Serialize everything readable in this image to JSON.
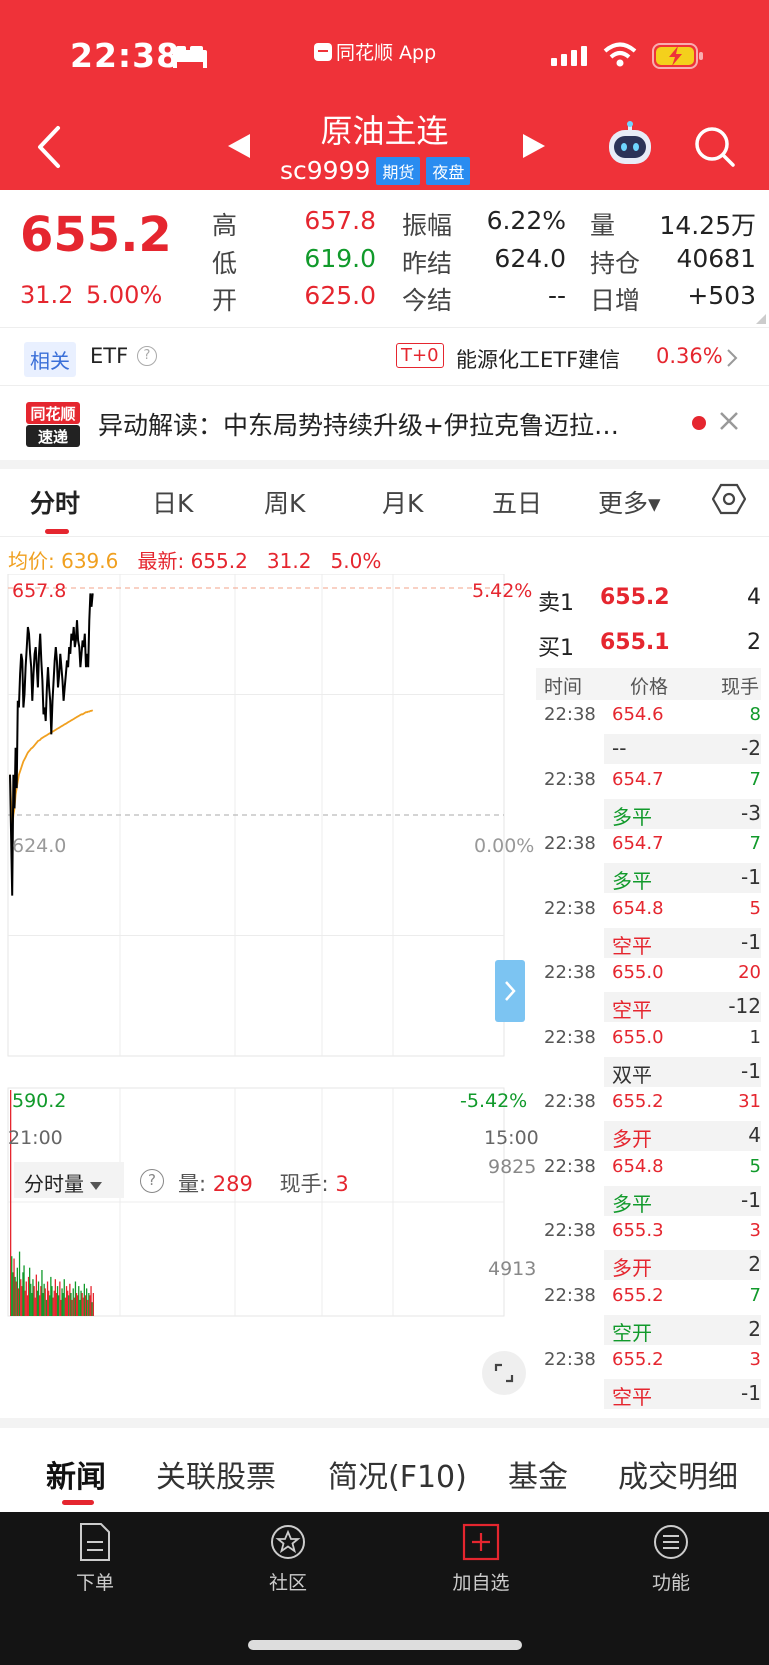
{
  "status_bar": {
    "time": "22:38",
    "app_label": "同花顺 App"
  },
  "header": {
    "title": "原油主连",
    "code": "sc9999",
    "tags": [
      "期货",
      "夜盘"
    ]
  },
  "quote": {
    "last": "655.2",
    "change": "31.2",
    "change_pct": "5.00%",
    "fields": [
      {
        "label": "高",
        "value": "657.8",
        "color": "#e5262f"
      },
      {
        "label": "振幅",
        "value": "6.22%",
        "color": "#222222"
      },
      {
        "label": "量",
        "value": "14.25万",
        "color": "#222222"
      },
      {
        "label": "低",
        "value": "619.0",
        "color": "#119a2b"
      },
      {
        "label": "昨结",
        "value": "624.0",
        "color": "#222222"
      },
      {
        "label": "持仓",
        "value": "40681",
        "color": "#222222"
      },
      {
        "label": "开",
        "value": "625.0",
        "color": "#e5262f"
      },
      {
        "label": "今结",
        "value": "--",
        "color": "#222222"
      },
      {
        "label": "日增",
        "value": "+503",
        "color": "#222222"
      }
    ]
  },
  "etf": {
    "related": "相关",
    "label": "ETF",
    "help": "?",
    "t0": "T+0",
    "name": "能源化工ETF建信",
    "change": "0.36%"
  },
  "news": {
    "logo_top": "同花顺",
    "logo_bottom": "速递",
    "text": "异动解读：中东局势持续升级+伊拉克鲁迈拉…"
  },
  "period_tabs": [
    "分时",
    "日K",
    "周K",
    "月K",
    "五日",
    "更多▾"
  ],
  "chart_header": {
    "avg_label": "均价:",
    "avg_value": "639.6",
    "latest_label": "最新:",
    "latest_value": "655.2",
    "change": "31.2",
    "change_pct": "5.0%"
  },
  "chart_data": {
    "type": "line",
    "x_start": "21:00",
    "x_end": "15:00",
    "ylim": [
      590.2,
      657.8
    ],
    "reference": 624.0,
    "price_labels": {
      "top": "657.8",
      "mid": "624.0",
      "bottom": "590.2"
    },
    "pct_labels": {
      "top": "5.42%",
      "mid": "0.00%",
      "bottom": "-5.42%"
    },
    "series": [
      {
        "values": [
          630,
          621,
          612,
          630,
          625,
          634,
          628,
          641,
          640,
          645,
          648,
          647,
          640,
          642,
          646,
          649,
          652,
          651,
          648,
          646,
          641,
          645,
          648,
          649,
          646,
          643,
          648,
          651,
          647,
          644,
          639,
          640,
          638,
          643,
          646,
          643,
          641,
          636,
          641,
          644,
          647,
          649,
          647,
          643,
          645,
          648,
          646,
          644,
          641,
          643,
          645,
          647,
          646,
          649,
          648,
          651,
          650,
          652,
          649,
          650,
          653,
          650,
          649,
          646,
          648,
          650,
          649,
          651,
          646,
          648,
          646,
          653,
          657,
          655,
          657
        ]
      },
      {
        "values": [
          630,
          626,
          622,
          624,
          625,
          627,
          628,
          629,
          630,
          630.5,
          631,
          631.5,
          632,
          632.3,
          632.6,
          633,
          633.3,
          633.5,
          633.7,
          633.9,
          634,
          634.2,
          634.4,
          634.6,
          634.8,
          635,
          635.1,
          635.2,
          635.4,
          635.5,
          635.6,
          635.7,
          635.8,
          635.9,
          636,
          636.1,
          636.2,
          636.3,
          636.4,
          636.5,
          636.6,
          636.7,
          636.8,
          636.9,
          637,
          637.1,
          637.2,
          637.3,
          637.4,
          637.5,
          637.6,
          637.7,
          637.8,
          637.9,
          638,
          638.1,
          638.2,
          638.3,
          638.4,
          638.5,
          638.6,
          638.7,
          638.8,
          638.9,
          639,
          639,
          639.1,
          639.2,
          639.3,
          639.3,
          639.4,
          639.4,
          639.5,
          639.5,
          639.6
        ]
      }
    ],
    "volume": {
      "ymax_label": "9825",
      "ymid_label": "4913",
      "values": [
        9825,
        2600,
        1900,
        2500,
        1700,
        1500,
        2100,
        1200,
        2800,
        1600,
        1300,
        1900,
        2200,
        1100,
        1500,
        900,
        1700,
        2100,
        1400,
        1000,
        1600,
        1300,
        800,
        1800,
        1100,
        1500,
        900,
        1300,
        2000,
        1000,
        1400,
        1200,
        700,
        1500,
        1100,
        900,
        1700,
        1300,
        800,
        1100,
        1600,
        1000,
        1300,
        900,
        1500,
        700,
        1200,
        1000,
        1600,
        800,
        1300,
        1100,
        900,
        1400,
        1000,
        700,
        1200,
        800,
        1500,
        1000,
        900,
        1300,
        700,
        1100,
        1000,
        800,
        1400,
        900,
        1200,
        700,
        1000,
        900,
        1300,
        600,
        1000
      ]
    }
  },
  "order_book": {
    "sell": {
      "label": "卖1",
      "price": "655.2",
      "vol": "4"
    },
    "buy": {
      "label": "买1",
      "price": "655.1",
      "vol": "2"
    }
  },
  "ticks_header": {
    "time": "时间",
    "price": "价格",
    "vol": "现手"
  },
  "ticks": [
    {
      "time": "22:38",
      "price": "654.6",
      "vol": "8",
      "vol_color": "#119a2b",
      "nature": "--",
      "nature_color": "#333333",
      "oi": "-2"
    },
    {
      "time": "22:38",
      "price": "654.7",
      "vol": "7",
      "vol_color": "#119a2b",
      "nature": "多平",
      "nature_color": "#119a2b",
      "oi": "-3"
    },
    {
      "time": "22:38",
      "price": "654.7",
      "vol": "7",
      "vol_color": "#119a2b",
      "nature": "多平",
      "nature_color": "#119a2b",
      "oi": "-1"
    },
    {
      "time": "22:38",
      "price": "654.8",
      "vol": "5",
      "vol_color": "#e5262f",
      "nature": "空平",
      "nature_color": "#e5262f",
      "oi": "-1"
    },
    {
      "time": "22:38",
      "price": "655.0",
      "vol": "20",
      "vol_color": "#e5262f",
      "nature": "空平",
      "nature_color": "#e5262f",
      "oi": "-12"
    },
    {
      "time": "22:38",
      "price": "655.0",
      "vol": "1",
      "vol_color": "#333333",
      "nature": "双平",
      "nature_color": "#333333",
      "oi": "-1"
    },
    {
      "time": "22:38",
      "price": "655.2",
      "vol": "31",
      "vol_color": "#e5262f",
      "nature": "多开",
      "nature_color": "#e5262f",
      "oi": "4"
    },
    {
      "time": "22:38",
      "price": "654.8",
      "vol": "5",
      "vol_color": "#119a2b",
      "nature": "多平",
      "nature_color": "#119a2b",
      "oi": "-1"
    },
    {
      "time": "22:38",
      "price": "655.3",
      "vol": "3",
      "vol_color": "#e5262f",
      "nature": "多开",
      "nature_color": "#e5262f",
      "oi": "2"
    },
    {
      "time": "22:38",
      "price": "655.2",
      "vol": "7",
      "vol_color": "#119a2b",
      "nature": "空开",
      "nature_color": "#119a2b",
      "oi": "2"
    },
    {
      "time": "22:38",
      "price": "655.2",
      "vol": "3",
      "vol_color": "#e5262f",
      "nature": "空平",
      "nature_color": "#e5262f",
      "oi": "-1"
    }
  ],
  "volume_panel": {
    "selector": "分时量",
    "help": "?",
    "vol_label": "量:",
    "vol_value": "289",
    "hand_label": "现手:",
    "hand_value": "3"
  },
  "bottom_tabs": [
    "新闻",
    "关联股票",
    "简况(F10)",
    "基金",
    "成交明细"
  ],
  "toolbar": [
    {
      "label": "下单",
      "icon": "document-icon"
    },
    {
      "label": "社区",
      "icon": "community-star-icon"
    },
    {
      "label": "加自选",
      "icon": "add-box-icon"
    },
    {
      "label": "功能",
      "icon": "menu-circle-icon"
    }
  ],
  "colors": {
    "brand": "#ef3239",
    "up": "#e5262f",
    "down": "#119a2b",
    "avg": "#f0a020",
    "tag": "#2a8cf0"
  }
}
